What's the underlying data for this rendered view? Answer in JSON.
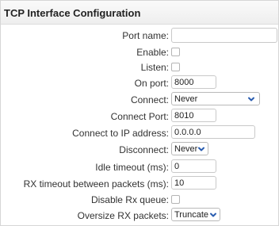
{
  "panel": {
    "title": "TCP Interface Configuration"
  },
  "fields": {
    "port_name": {
      "label": "Port name:",
      "value": ""
    },
    "enable": {
      "label": "Enable:"
    },
    "listen": {
      "label": "Listen:"
    },
    "on_port": {
      "label": "On port:",
      "value": "8000"
    },
    "connect": {
      "label": "Connect:",
      "value": "Never"
    },
    "connect_port": {
      "label": "Connect Port:",
      "value": "8010"
    },
    "connect_ip": {
      "label": "Connect to IP address:",
      "value": "0.0.0.0"
    },
    "disconnect": {
      "label": "Disconnect:",
      "value": "Never"
    },
    "idle_timeout": {
      "label": "Idle timeout (ms):",
      "value": "0"
    },
    "rx_timeout": {
      "label": "RX timeout between packets (ms):",
      "value": "10"
    },
    "disable_rx_queue": {
      "label": "Disable Rx queue:"
    },
    "oversize_rx": {
      "label": "Oversize RX packets:",
      "value": "Truncate"
    }
  },
  "icons": {
    "dropdown": "chevron-down-icon"
  },
  "colors": {
    "chevron": "#2a5db0",
    "header_bg": "#f2f2f2",
    "border": "#c9c9c9"
  }
}
